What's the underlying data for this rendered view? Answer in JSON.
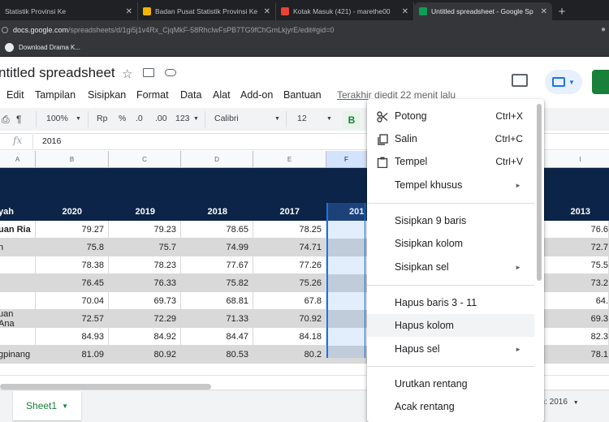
{
  "browser": {
    "tabs": [
      {
        "title": "Statistik Provinsi Ke",
        "favicon_color": "#f4b400"
      },
      {
        "title": "Badan Pusat Statistik Provinsi Ke",
        "favicon_color": "#f4b400"
      },
      {
        "title": "Kotak Masuk (421) - marethe00",
        "favicon_color": "#ea4335"
      },
      {
        "title": "Untitled spreadsheet - Google Sp",
        "favicon_color": "#0f9d58"
      }
    ],
    "url_host": "docs.google.com",
    "url_path": "/spreadsheets/d/1gi5j1v4Rx_CjqMkF-58RhcIwFsPB7TG9fChGmLkjyrE/edit#gid=0",
    "bookmark": "Download Drama K..."
  },
  "sheets": {
    "title": "ntitled spreadsheet",
    "menu": [
      "Edit",
      "Tampilan",
      "Sisipkan",
      "Format",
      "Data",
      "Alat",
      "Add-on",
      "Bantuan"
    ],
    "last_edit": "Terakhir diedit 22 menit lalu",
    "toolbar": {
      "zoom": "100%",
      "currency": "Rp",
      "percent": "%",
      "dec_less": ".0",
      "dec_more": ".00",
      "more_formats": "123",
      "font": "Calibri",
      "size": "12",
      "bold": "B"
    },
    "formula_value": "2016",
    "fx": "fx"
  },
  "grid": {
    "columns": [
      "A",
      "B",
      "C",
      "D",
      "E",
      "F",
      "I"
    ],
    "header_label": "yah",
    "years": [
      "2020",
      "2019",
      "2018",
      "2017",
      "201",
      "2013"
    ],
    "rows": [
      {
        "name": "uan Ria",
        "values": [
          "79.27",
          "79.23",
          "78.65",
          "78.25"
        ],
        "last": "76.6",
        "bold": true
      },
      {
        "name": "n",
        "values": [
          "75.8",
          "75.7",
          "74.99",
          "74.71"
        ],
        "last": "72.7",
        "bold": false
      },
      {
        "name": "",
        "values": [
          "78.38",
          "78.23",
          "77.67",
          "77.26"
        ],
        "last": "75.5",
        "bold": false
      },
      {
        "name": "",
        "values": [
          "76.45",
          "76.33",
          "75.82",
          "75.26"
        ],
        "last": "73.2",
        "bold": false
      },
      {
        "name": "",
        "values": [
          "70.04",
          "69.73",
          "68.81",
          "67.8"
        ],
        "last": "64.",
        "bold": false
      },
      {
        "name": "uan Ana",
        "values": [
          "72.57",
          "72.29",
          "71.33",
          "70.92"
        ],
        "last": "69.3",
        "bold": false
      },
      {
        "name": "",
        "values": [
          "84.93",
          "84.92",
          "84.47",
          "84.18"
        ],
        "last": "82.3",
        "bold": false
      },
      {
        "name": "gpinang",
        "values": [
          "81.09",
          "80.92",
          "80.53",
          "80.2"
        ],
        "last": "78.1",
        "bold": false
      }
    ]
  },
  "bottom": {
    "sheet_name": "Sheet1",
    "explore": "ah: 2016"
  },
  "context_menu": {
    "cut": {
      "label": "Potong",
      "shortcut": "Ctrl+X"
    },
    "copy": {
      "label": "Salin",
      "shortcut": "Ctrl+C"
    },
    "paste": {
      "label": "Tempel",
      "shortcut": "Ctrl+V"
    },
    "paste_special": {
      "label": "Tempel khusus"
    },
    "insert_rows": {
      "label": "Sisipkan 9 baris"
    },
    "insert_column": {
      "label": "Sisipkan kolom"
    },
    "insert_cells": {
      "label": "Sisipkan sel"
    },
    "delete_rows": {
      "label": "Hapus baris 3 - 11"
    },
    "delete_column": {
      "label": "Hapus kolom"
    },
    "delete_cells": {
      "label": "Hapus sel"
    },
    "sort_range": {
      "label": "Urutkan rentang"
    },
    "randomize_range": {
      "label": "Acak rentang"
    }
  }
}
